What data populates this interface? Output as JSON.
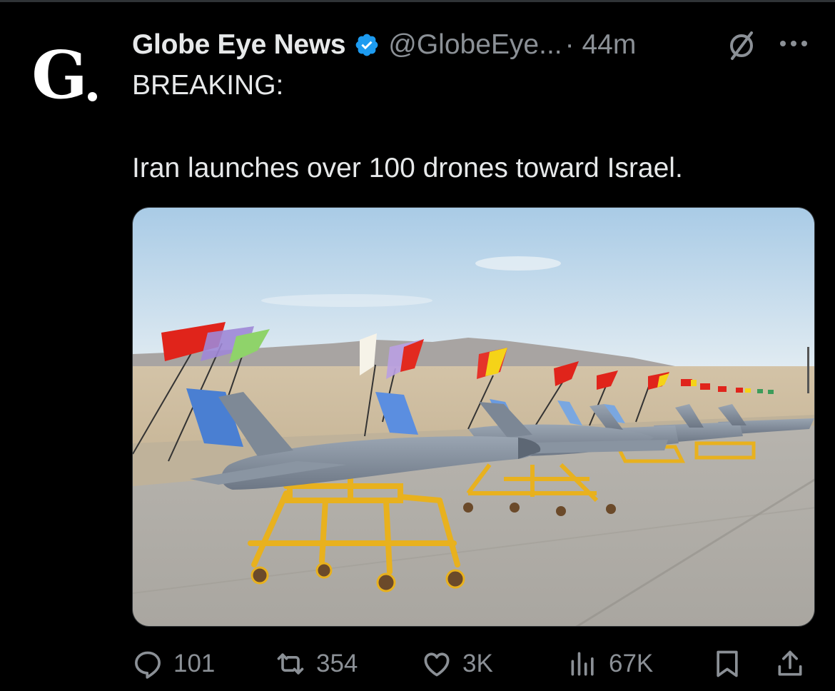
{
  "tweet": {
    "author_name": "Globe Eye News",
    "author_handle": "@GlobeEye...",
    "time": "· 44m",
    "avatar_letter": "G",
    "line1": "BREAKING:",
    "line2": "Iran launches over 100 drones toward Israel.",
    "media_description": "Drones on yellow wheeled stands with flags in desert"
  },
  "actions": {
    "replies": "101",
    "reposts": "354",
    "likes": "3K",
    "views": "67K"
  },
  "colors": {
    "background": "#000000",
    "verified": "#1d9bf0",
    "secondary_text": "#8b9096",
    "primary_text": "#e7e9ea"
  },
  "icons": [
    "verified-badge-icon",
    "grok-icon",
    "more-icon",
    "reply-icon",
    "repost-icon",
    "like-icon",
    "views-icon",
    "bookmark-icon",
    "share-icon"
  ]
}
